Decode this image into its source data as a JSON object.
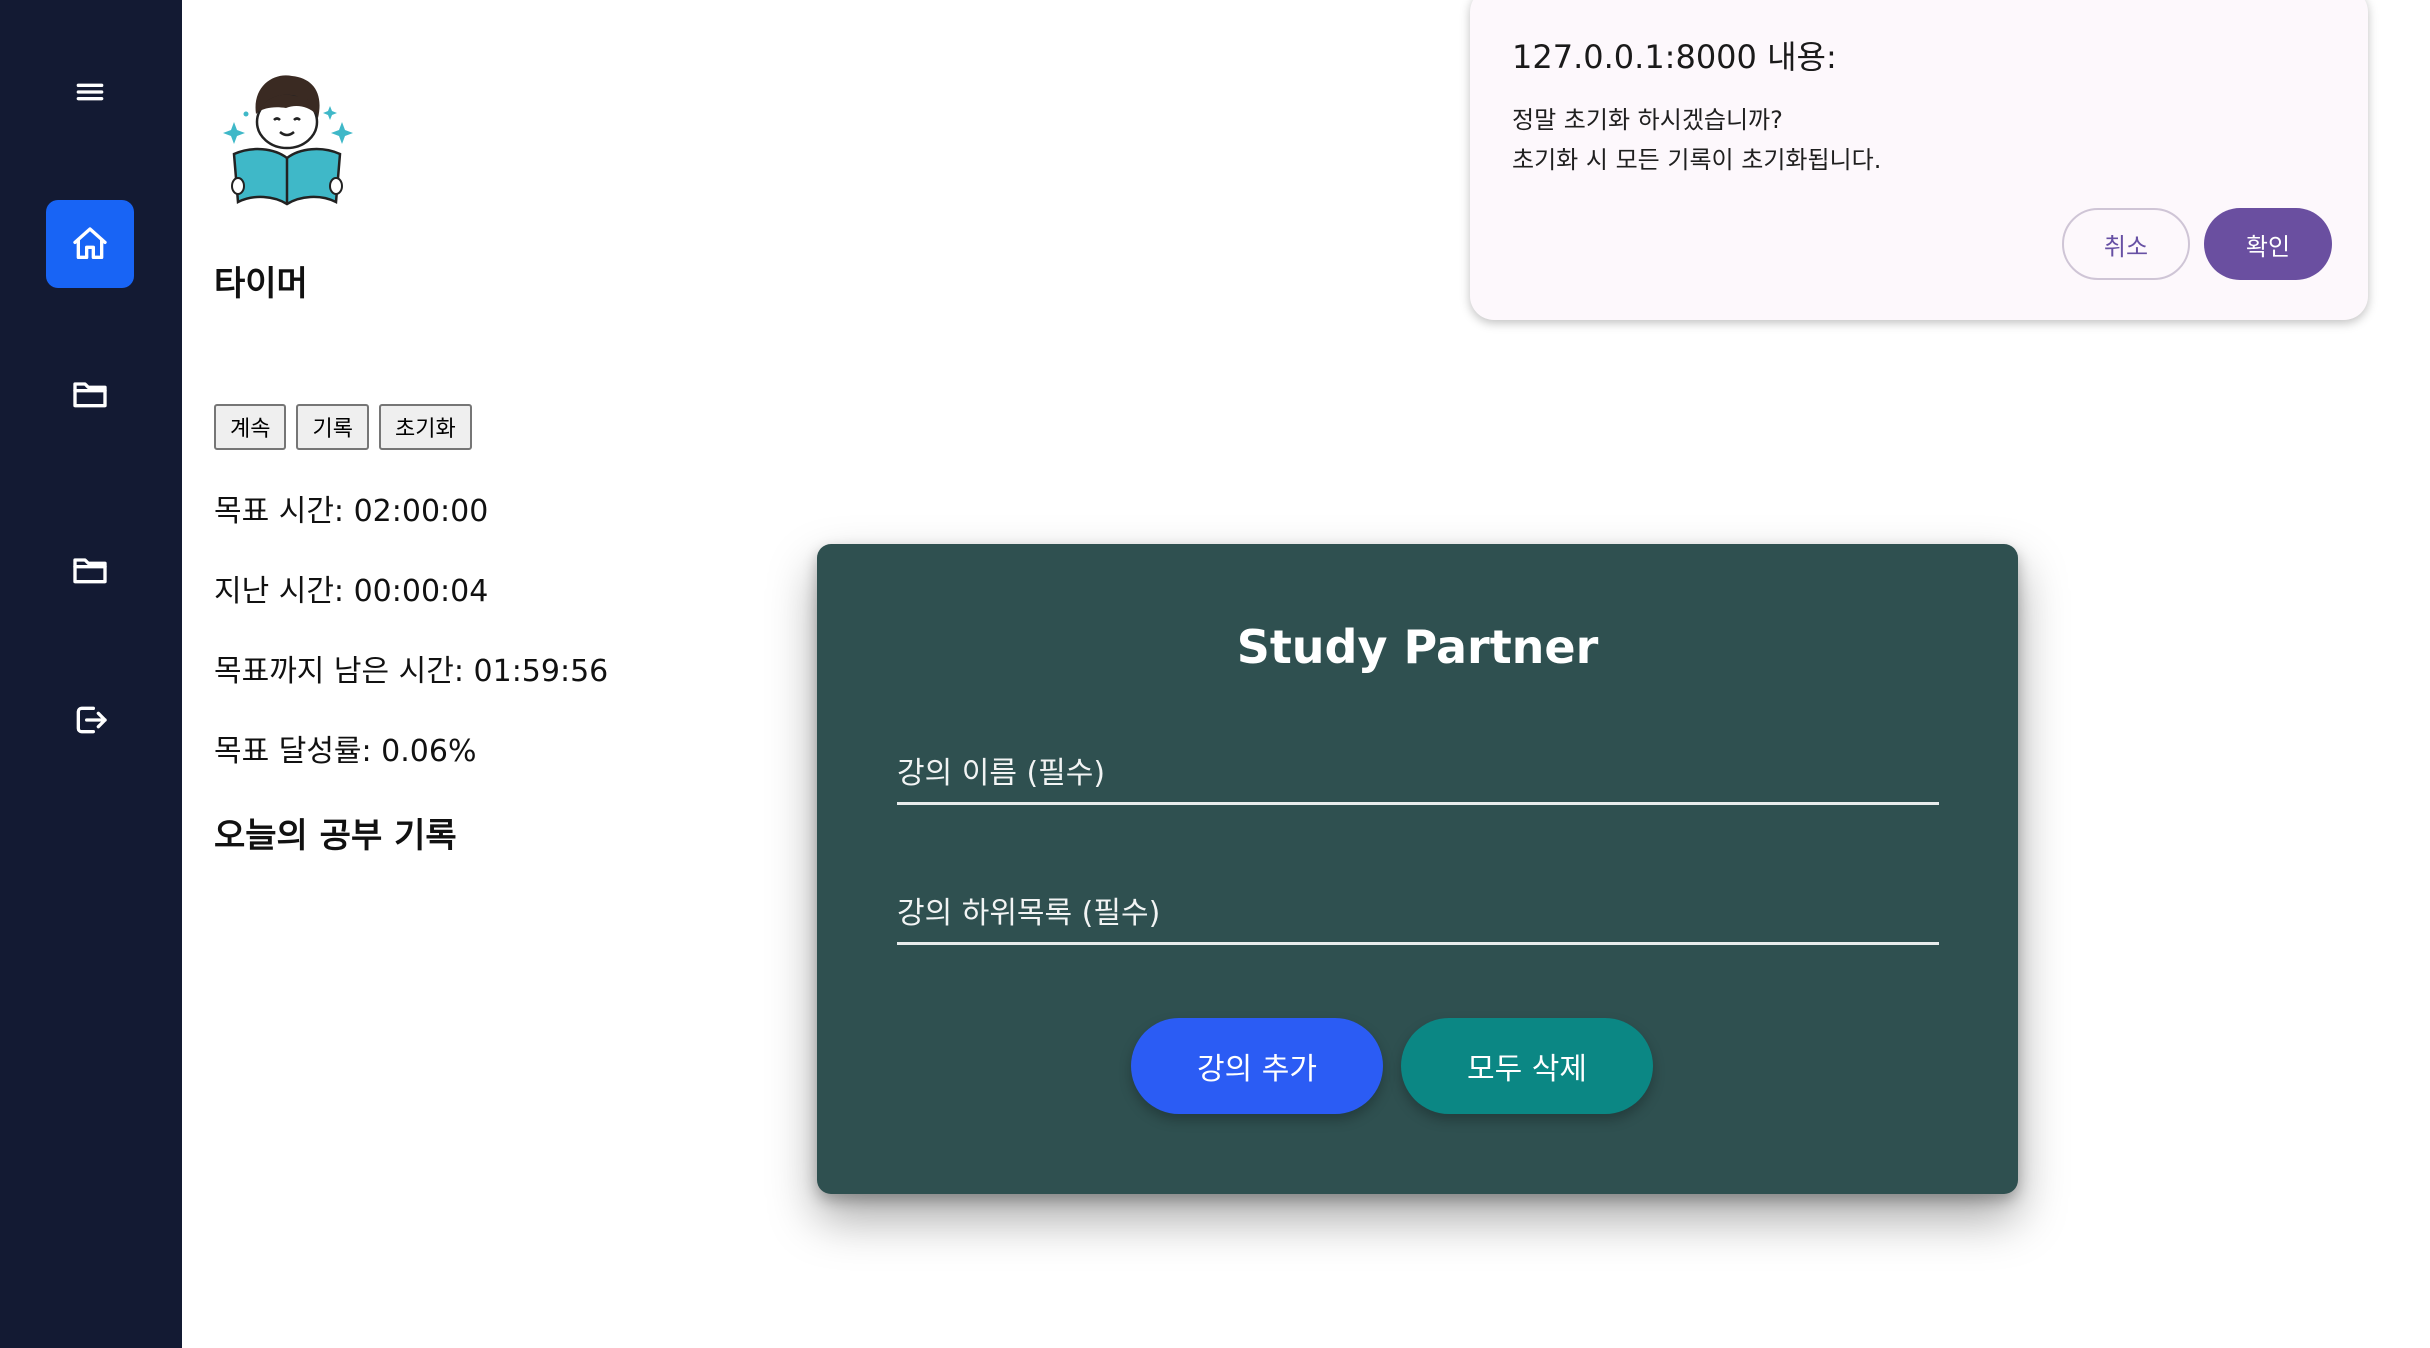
{
  "sidebar": {
    "items": [
      {
        "icon": "menu-icon"
      },
      {
        "icon": "home-icon",
        "active": true
      },
      {
        "icon": "folder-icon"
      },
      {
        "icon": "folder-icon"
      },
      {
        "icon": "logout-icon"
      }
    ]
  },
  "main": {
    "title": "타이머",
    "buttons": {
      "continue": "계속",
      "record": "기록",
      "reset": "초기화"
    },
    "stats": {
      "target_time": "목표 시간: 02:00:00",
      "elapsed_time": "지난 시간: 00:00:04",
      "remaining_time": "목표까지 남은 시간: 01:59:56",
      "achievement": "목표 달성률: 0.06%"
    },
    "today_record_title": "오늘의 공부 기록"
  },
  "modal": {
    "title": "Study Partner",
    "lecture_name_placeholder": "강의 이름 (필수)",
    "lecture_sub_placeholder": "강의 하위목록 (필수)",
    "add_button": "강의 추가",
    "delete_all_button": "모두 삭제",
    "colors": {
      "background": "#2f5050",
      "add_button": "#2b5cf4",
      "delete_all_button": "#0b8784"
    }
  },
  "dialog": {
    "title": "127.0.0.1:8000 내용:",
    "message_line1": "정말 초기화 하시겠습니까?",
    "message_line2": "초기화 시 모든 기록이 초기화됩니다.",
    "cancel": "취소",
    "confirm": "확인",
    "colors": {
      "confirm_button": "#6a4fa0"
    }
  },
  "colors": {
    "sidebar_bg": "#131a33",
    "active_nav": "#1864f5"
  }
}
